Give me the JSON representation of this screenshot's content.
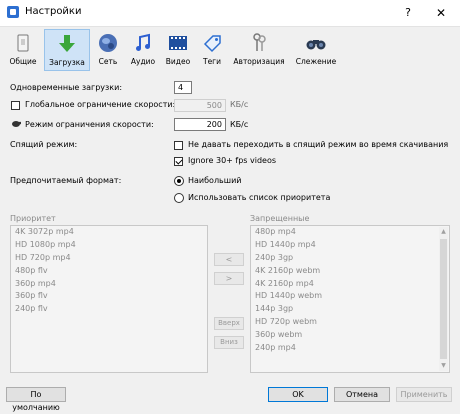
{
  "window": {
    "title": "Настройки",
    "help_label": "?",
    "close_label": "✕"
  },
  "tabs": [
    {
      "label": "Общие",
      "icon": "general-icon"
    },
    {
      "label": "Загрузка",
      "icon": "download-arrow-icon",
      "active": true
    },
    {
      "label": "Сеть",
      "icon": "globe-icon"
    },
    {
      "label": "Аудио",
      "icon": "music-note-icon"
    },
    {
      "label": "Видео",
      "icon": "film-icon"
    },
    {
      "label": "Теги",
      "icon": "tag-icon"
    },
    {
      "label": "Авторизация",
      "icon": "keys-icon"
    },
    {
      "label": "Слежение",
      "icon": "binoculars-icon"
    }
  ],
  "settings": {
    "concurrent_label": "Одновременные загрузки:",
    "concurrent_value": "4",
    "global_limit_label": "Глобальное ограничение скорости:",
    "global_limit_checked": false,
    "global_limit_value": "500",
    "global_limit_unit": "КБ/с",
    "limit_mode_label": "Режим ограничения скорости:",
    "limit_mode_value": "200",
    "limit_mode_unit": "КБ/с",
    "sleep_label": "Спящий режим:",
    "sleep_option": "Не давать переходить в спящий режим во время скачивания",
    "sleep_checked": false,
    "ignore_fps_label": "Ignore 30+ fps videos",
    "ignore_fps_checked": true,
    "preferred_label": "Предпочитаемый формат:",
    "preferred_options": [
      {
        "label": "Наибольший",
        "checked": true
      },
      {
        "label": "Использовать список приоритета",
        "checked": false
      }
    ]
  },
  "priority": {
    "label": "Приоритет",
    "items": [
      "4K 3072p mp4",
      "HD 1080p mp4",
      "HD 720p mp4",
      "480p flv",
      "360p mp4",
      "360p flv",
      "240p flv"
    ]
  },
  "forbidden": {
    "label": "Запрещенные",
    "items": [
      "480p mp4",
      "HD 1440p mp4",
      "240p 3gp",
      "4K 2160p webm",
      "4K 2160p mp4",
      "HD 1440p webm",
      "144p 3gp",
      "HD 720p webm",
      "360p webm",
      "240p mp4"
    ]
  },
  "list_buttons": {
    "move_left": "<",
    "move_right": ">",
    "up": "Вверх",
    "down": "Вниз"
  },
  "footer": {
    "defaults": "По умолчанию",
    "ok": "OK",
    "cancel": "Отмена",
    "apply": "Применить"
  }
}
